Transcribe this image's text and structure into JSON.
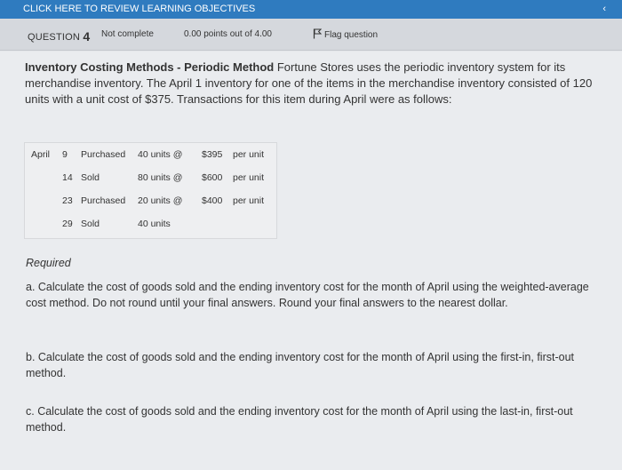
{
  "topbar": {
    "link_text": "CLICK HERE TO REVIEW LEARNING OBJECTIVES",
    "chevron": "‹"
  },
  "question_bar": {
    "question_label": "QUESTION",
    "question_number": "4",
    "status": "Not complete",
    "points": "0.00 points out of 4.00",
    "flag_label": "Flag question"
  },
  "problem": {
    "title": "Inventory Costing Methods - Periodic Method",
    "body": " Fortune Stores uses the periodic inventory system for its merchandise inventory. The April 1 inventory for one of the items in the merchandise inventory consisted of 120 units with a unit cost of $375. Transactions for this item during April were as follows:"
  },
  "transactions": [
    {
      "month": "April",
      "day": "9",
      "action": "Purchased",
      "units": "40  units @",
      "price": "$395",
      "per": "per unit"
    },
    {
      "month": "",
      "day": "14",
      "action": "Sold",
      "units": "80  units @",
      "price": "$600",
      "per": "per unit"
    },
    {
      "month": "",
      "day": "23",
      "action": "Purchased",
      "units": "20  units @",
      "price": "$400",
      "per": "per unit"
    },
    {
      "month": "",
      "day": "29",
      "action": "Sold",
      "units": "40  units",
      "price": "",
      "per": ""
    }
  ],
  "required": {
    "heading": "Required",
    "part_a": "a. Calculate the cost of goods sold and the ending inventory cost for the month of April using the weighted-average cost method. Do not round until your final answers. Round your final answers to the nearest dollar.",
    "part_b": "b. Calculate the cost of goods sold and the ending inventory cost for the month of April using the first-in, first-out method.",
    "part_c": "c. Calculate the cost of goods sold and the ending inventory cost for the month of April using the last-in, first-out method."
  },
  "colors": {
    "topbar": "#2f7bbf",
    "question_bar": "#d5d8dd",
    "content_bg": "#eaecef"
  }
}
